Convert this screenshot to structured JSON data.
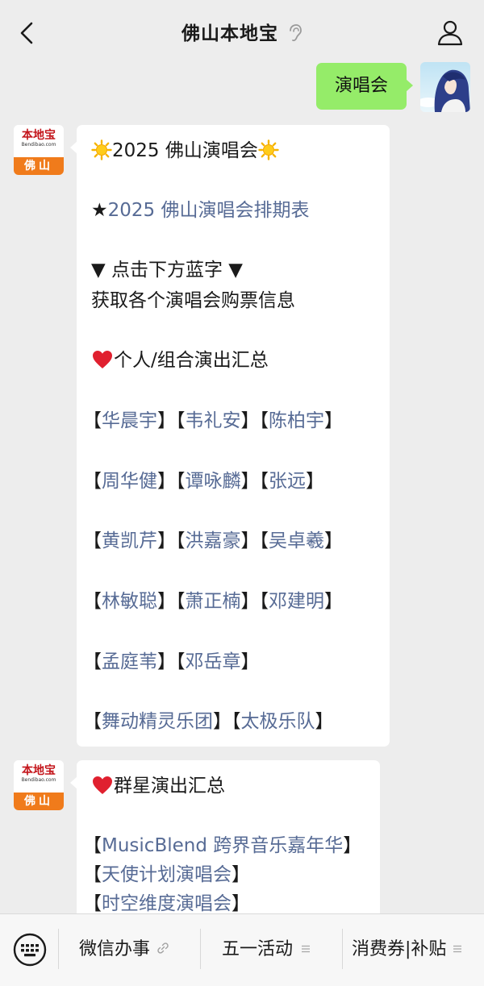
{
  "header": {
    "title": "佛山本地宝",
    "back_icon": "chevron-left-icon",
    "profile_icon": "person-icon",
    "ear_icon": "ear-icon"
  },
  "sent_message": {
    "text": "演唱会"
  },
  "bot": {
    "avatar_cn": "本地宝",
    "avatar_en": "Bendibao.com",
    "avatar_city": "佛山"
  },
  "message1": {
    "title": "2025 佛山演唱会",
    "schedule_star": "★",
    "schedule_link": "2025 佛山演唱会排期表",
    "instruction1": "▼ 点击下方蓝字 ▼",
    "instruction2": "获取各个演唱会购票信息",
    "section_title": "个人/组合演出汇总",
    "rows": [
      [
        "华晨宇",
        "韦礼安",
        "陈柏宇"
      ],
      [
        "周华健",
        "谭咏麟",
        "张远"
      ],
      [
        "黄凯芹",
        "洪嘉豪",
        "吴卓羲"
      ],
      [
        "林敏聪",
        "萧正楠",
        "邓建明"
      ],
      [
        "孟庭苇",
        "邓岳章"
      ],
      [
        "舞动精灵乐团",
        "太极乐队"
      ]
    ]
  },
  "message2": {
    "section_title": "群星演出汇总",
    "items": [
      "MusicBlend 跨界音乐嘉年华",
      "天使计划演唱会",
      "时空维度演唱会"
    ]
  },
  "bottom_menu": {
    "keyboard_icon": "keyboard-icon",
    "items": [
      {
        "label": "微信办事",
        "suffix": "link-icon"
      },
      {
        "label": "五一活动",
        "suffix": "menu-lines-icon"
      },
      {
        "label": "消费券|补贴",
        "suffix": "menu-lines-icon"
      }
    ]
  },
  "colors": {
    "background": "#ededed",
    "sent_bubble": "#95ec69",
    "link": "#576b95",
    "brand_orange": "#f07b1b",
    "brand_red": "#c4161c"
  }
}
